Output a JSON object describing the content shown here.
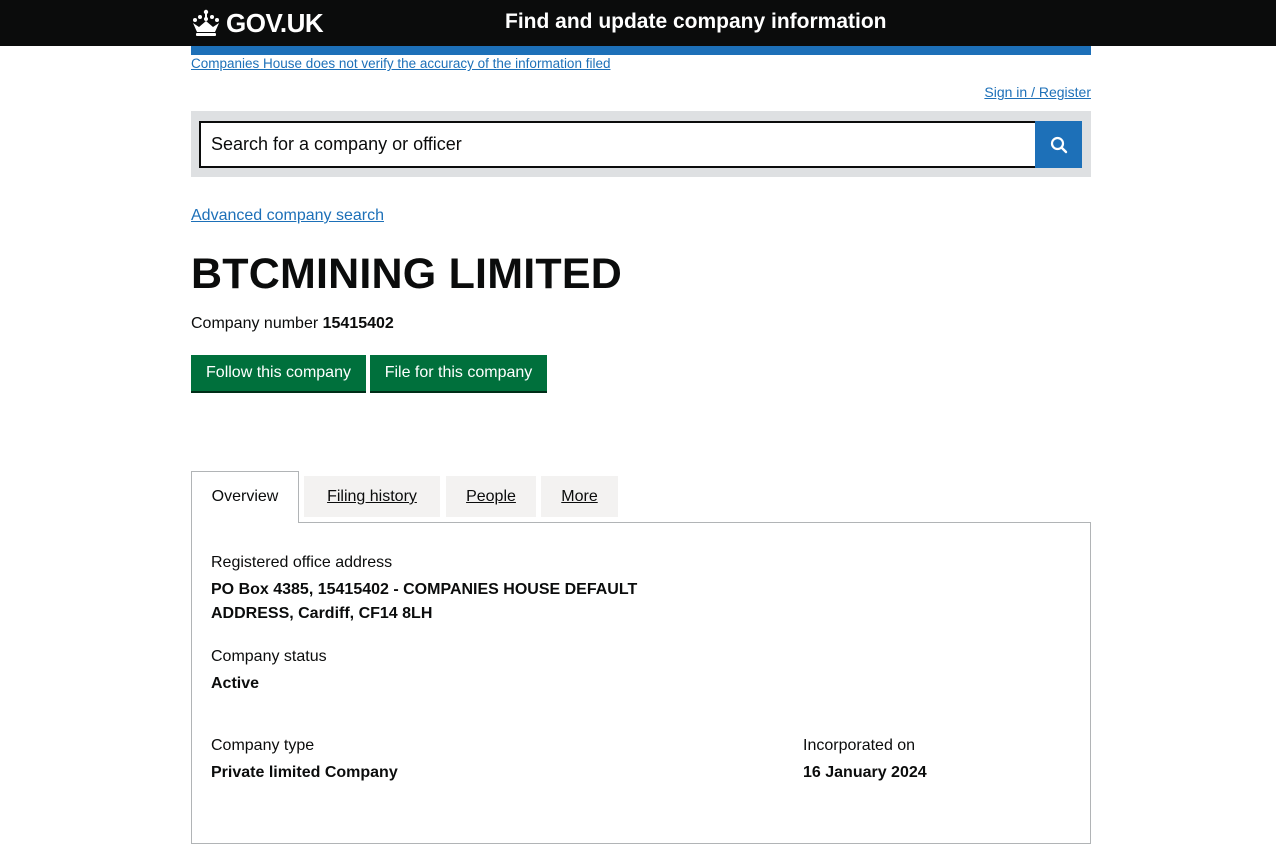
{
  "header": {
    "logo_text": "GOV.UK",
    "service_name": "Find and update company information"
  },
  "disclaimer": "Companies House does not verify the accuracy of the information filed",
  "signin": "Sign in / Register",
  "search": {
    "placeholder": "Search for a company or officer",
    "button_icon": "search-icon"
  },
  "advanced_search": "Advanced company search",
  "company": {
    "name": "BTCMINING LIMITED",
    "number_label": "Company number",
    "number": "15415402"
  },
  "actions": {
    "follow": "Follow this company",
    "file": "File for this company"
  },
  "tabs": [
    {
      "label": "Overview",
      "active": true
    },
    {
      "label": "Filing history",
      "active": false
    },
    {
      "label": "People",
      "active": false
    },
    {
      "label": "More",
      "active": false
    }
  ],
  "overview": {
    "address_label": "Registered office address",
    "address_line1": "PO Box 4385, 15415402 - COMPANIES HOUSE DEFAULT",
    "address_line2": "ADDRESS, Cardiff, CF14 8LH",
    "status_label": "Company status",
    "status_value": "Active",
    "type_label": "Company type",
    "type_value": "Private limited Company",
    "incorporated_label": "Incorporated on",
    "incorporated_value": "16 January 2024"
  },
  "colors": {
    "header_bg": "#0b0c0c",
    "link_blue": "#1d70b8",
    "button_green": "#00703c",
    "search_panel_bg": "#dee0e2",
    "tab_bg": "#f3f2f1"
  }
}
